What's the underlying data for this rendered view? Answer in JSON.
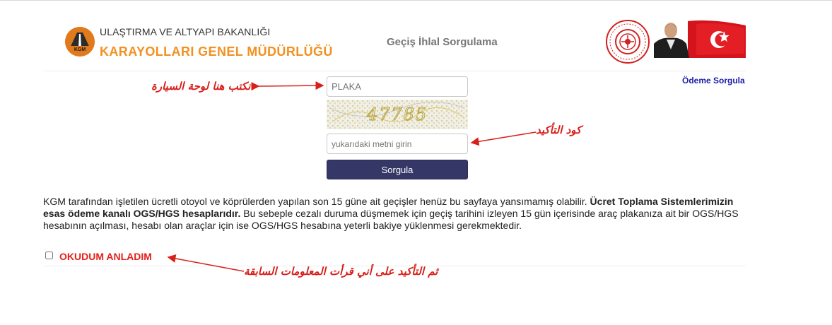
{
  "header": {
    "logo_text": "KGM",
    "ministry": "ULAŞTIRMA VE ALTYAPI BAKANLIĞI",
    "directorate": "KARAYOLLARI GENEL MÜDÜRLÜĞÜ",
    "page_title": "Geçiş İhlal Sorgulama"
  },
  "nav": {
    "payment_query_link": "Ödeme Sorgula"
  },
  "form": {
    "plate_placeholder": "PLAKA",
    "captcha_text": "47785",
    "code_placeholder": "yukarıdaki metni girin",
    "submit_label": "Sorgula"
  },
  "info": {
    "text_1": "KGM tarafından işletilen ücretli otoyol ve köprülerden yapılan son 15 güne ait geçişler henüz bu sayfaya yansımamış olabilir. ",
    "text_bold": "Ücret Toplama Sistemlerimizin esas ödeme kanalı OGS/HGS hesaplarıdır.",
    "text_2": " Bu sebeple cezalı duruma düşmemek için geçiş tarihini izleyen 15 gün içerisinde araç plakanıza ait bir OGS/HGS hesabının açılması, hesabı olan araçlar için ise OGS/HGS hesabına yeterli bakiye yüklenmesi gerekmektedir."
  },
  "agreement": {
    "label": "OKUDUM ANLADIM",
    "checked": false
  },
  "annotations": {
    "plate": "نكتب هنا لوحة السيارة",
    "code": "كود التأكيد",
    "confirm": "ثم التأكيد على أني قرأت المعلومات السابقة"
  },
  "colors": {
    "brand_orange": "#f29121",
    "button_navy": "#353866",
    "link_blue": "#1a1aa8",
    "alert_red": "#e3201b"
  }
}
